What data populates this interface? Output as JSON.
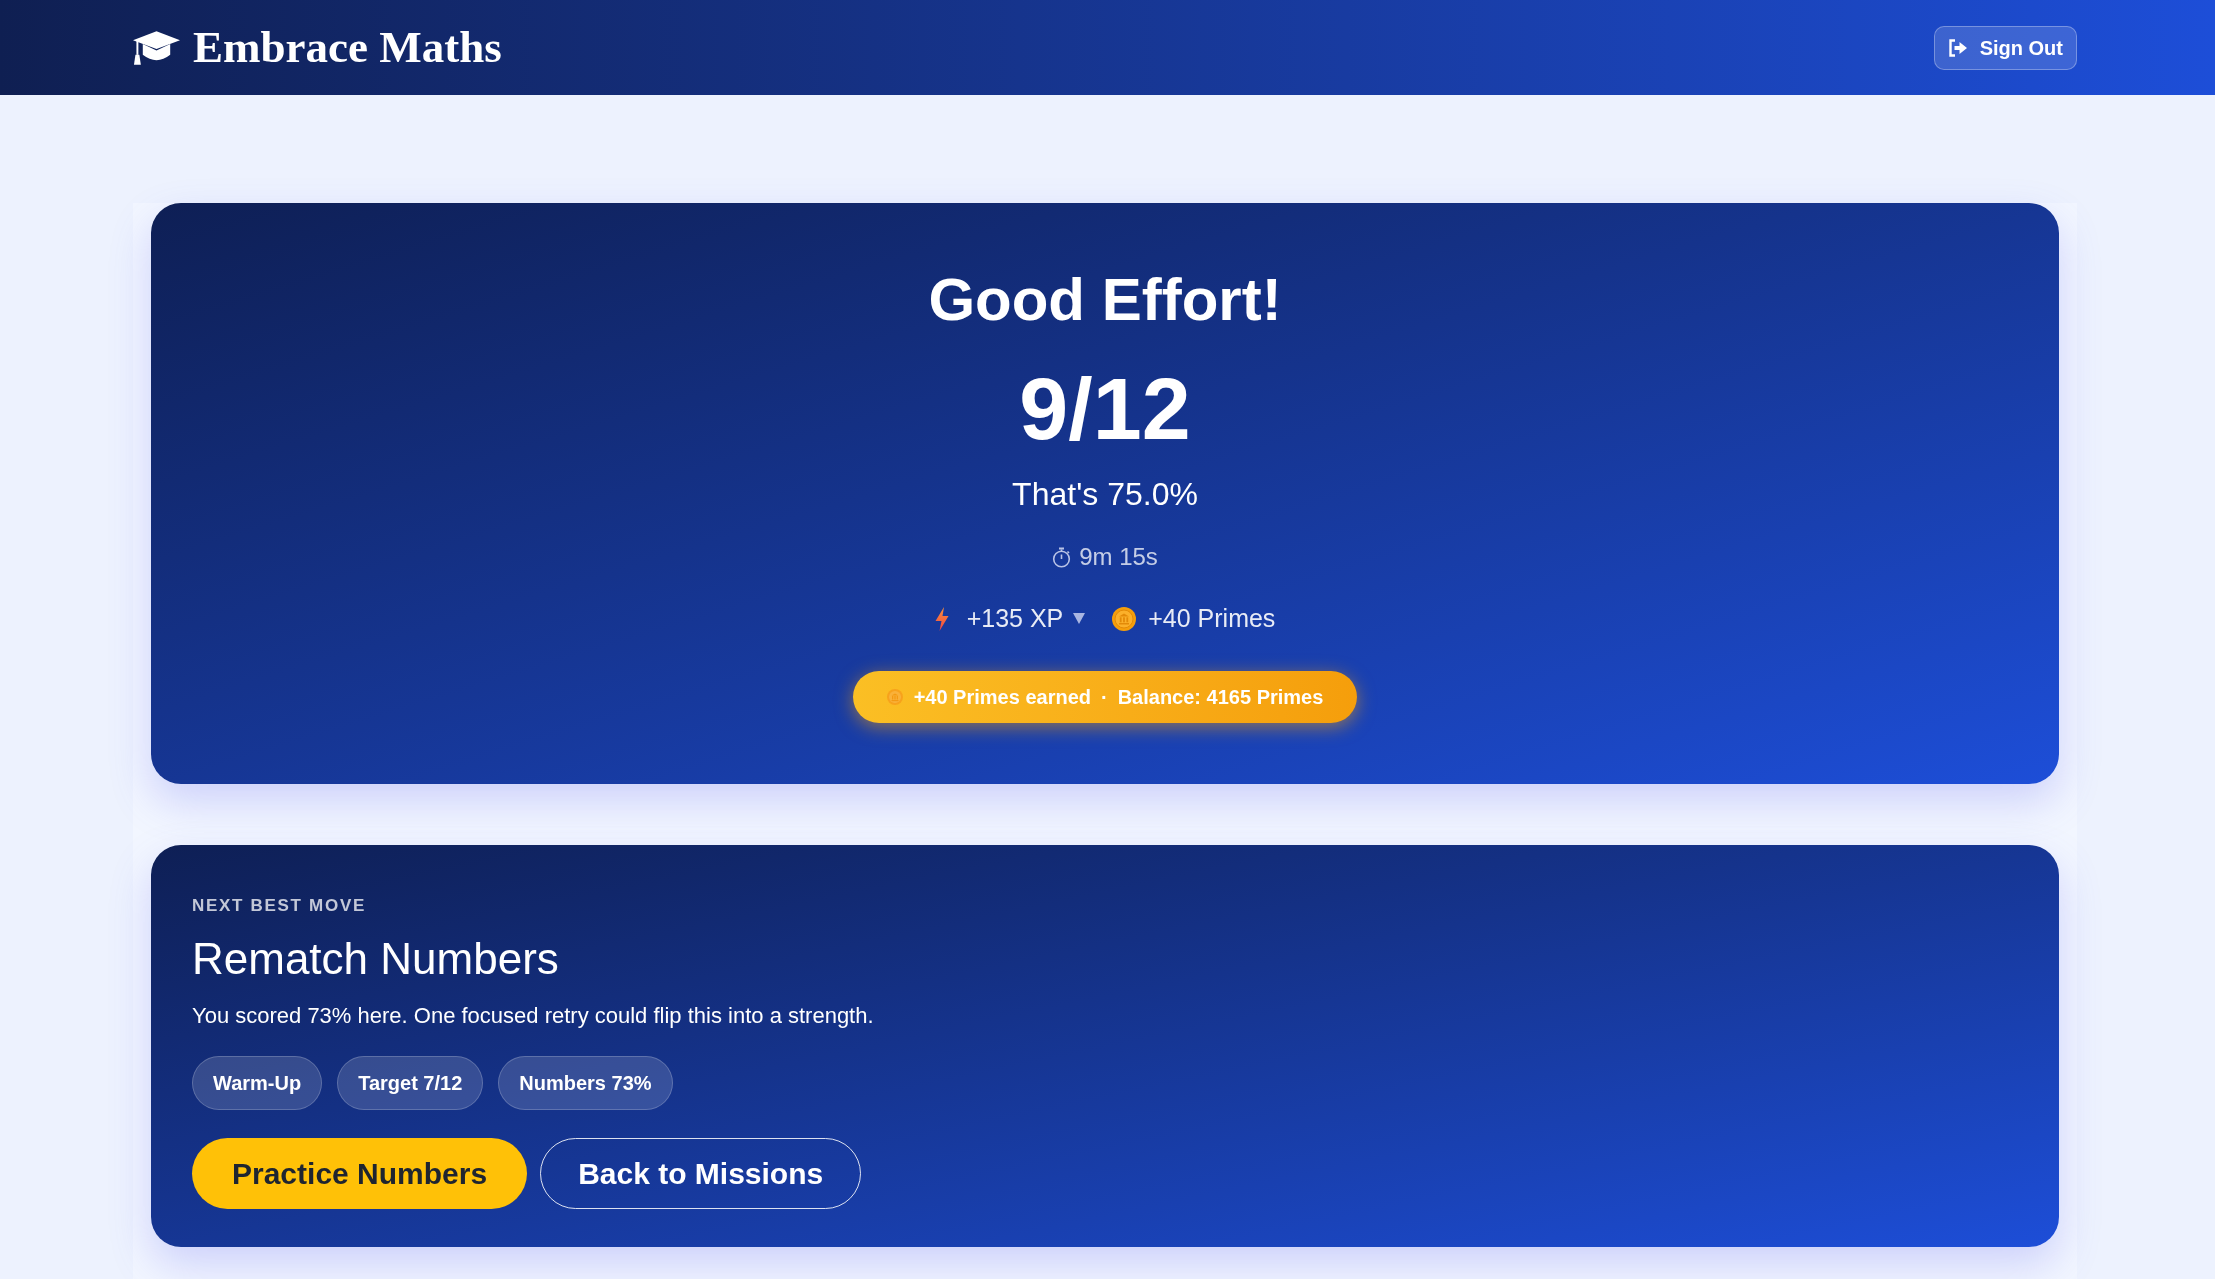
{
  "header": {
    "logo": "Embrace Maths",
    "sign_out": "Sign Out"
  },
  "result": {
    "heading": "Good Effort!",
    "score": "9/12",
    "percentage": "That's 75.0%",
    "duration": "9m 15s",
    "rewards": [
      {
        "kind": "xp",
        "text": "+135 XP"
      },
      {
        "kind": "primes",
        "text": "+40 Primes"
      }
    ],
    "banner": {
      "earned": "+40 Primes earned",
      "separator": "·",
      "balance": "Balance: 4165 Primes"
    }
  },
  "next_move": {
    "eyebrow": "NEXT BEST MOVE",
    "title": "Rematch Numbers",
    "description": "You scored 73% here. One focused retry could flip this into a strength.",
    "tags": [
      "Warm-Up",
      "Target 7/12",
      "Numbers 73%"
    ],
    "buttons": [
      {
        "kind": "primary",
        "label": "Practice Numbers"
      },
      {
        "kind": "secondary",
        "label": "Back to Missions"
      }
    ]
  }
}
